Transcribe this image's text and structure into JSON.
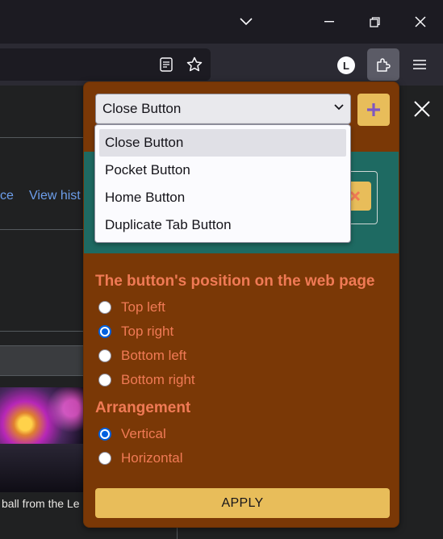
{
  "popup": {
    "select": {
      "selected": "Close Button",
      "options": [
        "Close Button",
        "Pocket Button",
        "Home Button",
        "Duplicate Tab Button"
      ]
    },
    "add_label": "+",
    "position_section": {
      "title": "The button's position on the web page",
      "options": [
        {
          "label": "Top left",
          "checked": false
        },
        {
          "label": "Top right",
          "checked": true
        },
        {
          "label": "Bottom left",
          "checked": false
        },
        {
          "label": "Bottom right",
          "checked": false
        }
      ]
    },
    "arrangement_section": {
      "title": "Arrangement",
      "options": [
        {
          "label": "Vertical",
          "checked": true
        },
        {
          "label": "Horizontal",
          "checked": false
        }
      ]
    },
    "apply_label": "APPLY"
  },
  "browser": {
    "avatar_letter": "L",
    "icons": [
      "chevron-down-icon",
      "minimize-icon",
      "restore-icon",
      "close-icon",
      "reader-view-icon",
      "bookmark-star-icon",
      "extensions-icon",
      "menu-icon"
    ]
  },
  "page": {
    "links": [
      "ce",
      "View hist"
    ],
    "caption": "ball from the Le"
  },
  "colors": {
    "popup_bg": "#7a3806",
    "accent_text": "#f07a55",
    "button_yellow": "#e8bd5a",
    "preview_band": "#1e6a62",
    "plus_purple": "#7e57c2",
    "radio_blue": "#0060df"
  }
}
